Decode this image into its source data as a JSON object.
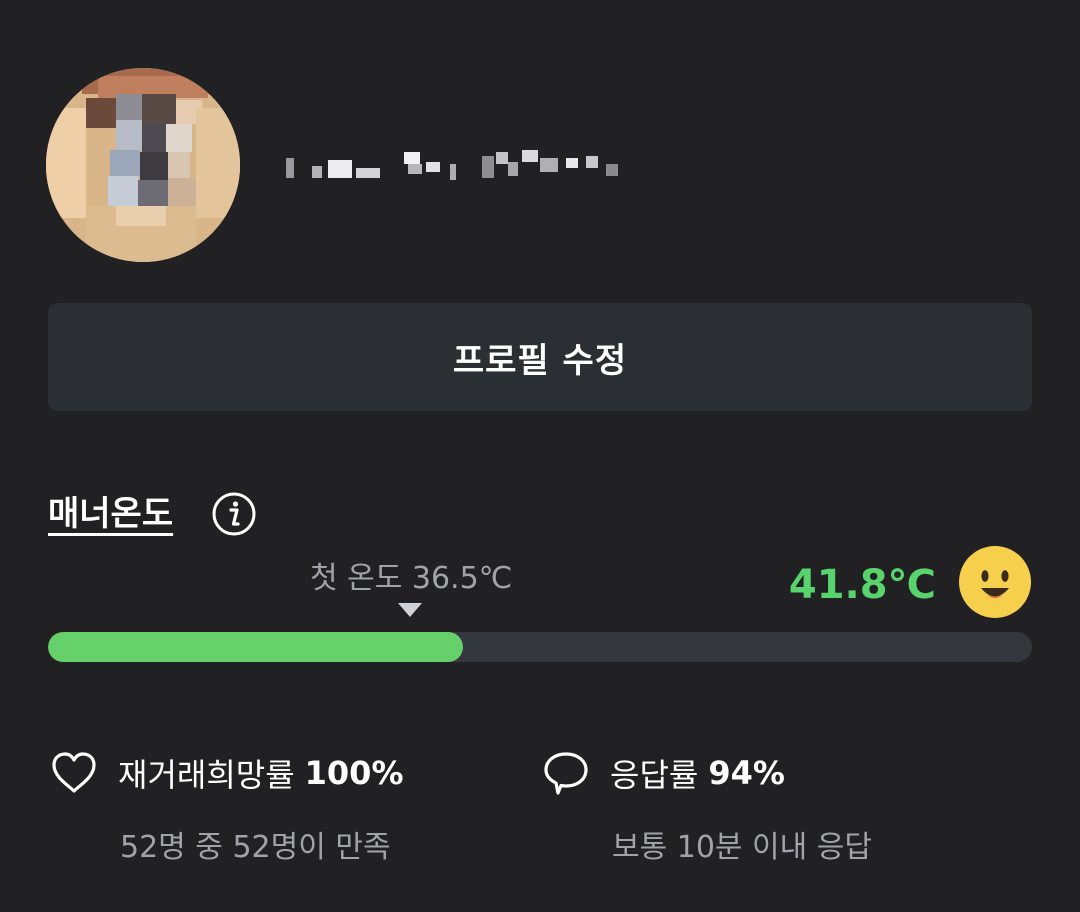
{
  "profile": {
    "avatar_icon": "profile-photo-blurred",
    "nickname_icon": "blurred-nickname"
  },
  "edit_button": {
    "label": "프로필 수정"
  },
  "manner": {
    "title": "매너온도",
    "info_icon": "info-icon",
    "first_temp_label": "첫 온도 36.5℃",
    "current_temp": "41.8℃",
    "face_icon": "smile-face-icon",
    "accent_color": "#66d06b",
    "bar_fill_percent": 42.2
  },
  "stats": {
    "rehire": {
      "icon": "heart-icon",
      "label": "재거래희망률",
      "value": "100%",
      "sub": "52명 중 52명이 만족"
    },
    "response": {
      "icon": "chat-bubble-icon",
      "label": "응답률",
      "value": "94%",
      "sub": "보통 10분 이내 응답"
    }
  }
}
